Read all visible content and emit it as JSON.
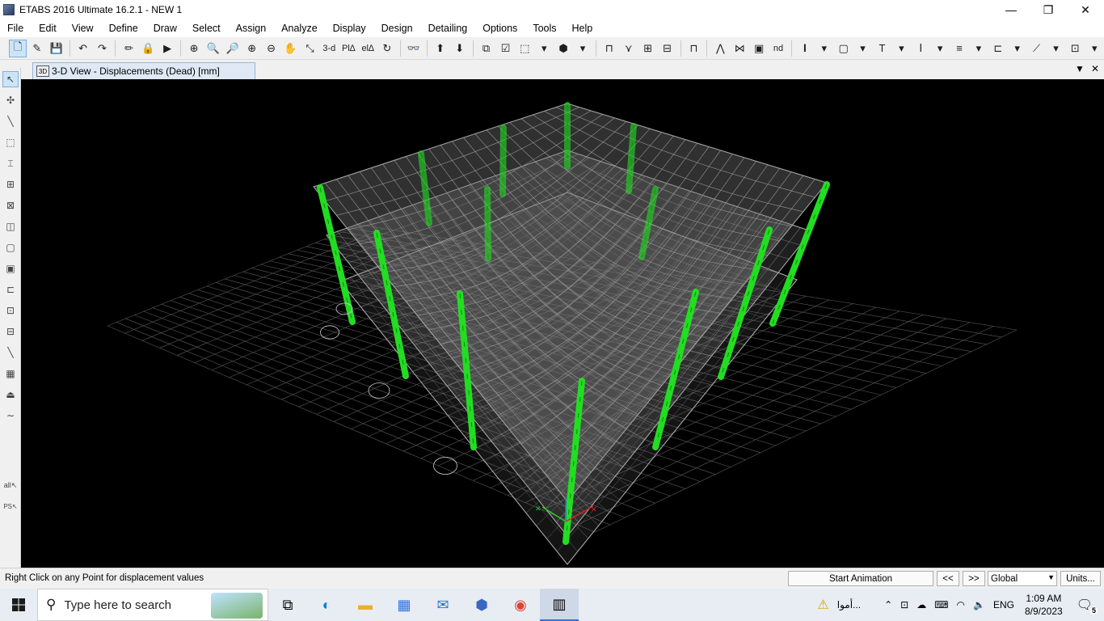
{
  "window": {
    "title": "ETABS 2016 Ultimate 16.2.1 - NEW 1",
    "minimize": "—",
    "maximize": "❐",
    "close": "✕"
  },
  "menu": [
    "File",
    "Edit",
    "View",
    "Define",
    "Draw",
    "Select",
    "Assign",
    "Analyze",
    "Display",
    "Design",
    "Detailing",
    "Options",
    "Tools",
    "Help"
  ],
  "toolbar": {
    "view3d_label": "3-d",
    "plan_label": "Pl∆",
    "elev_label": "el∆",
    "nd_label": "nd"
  },
  "tab": {
    "label": "3-D View   - Displacements (Dead)  [mm]"
  },
  "status": {
    "message": "Right Click on any Point for displacement values",
    "start_animation": "Start Animation",
    "prev": "<<",
    "next": ">>",
    "coord_system": "Global",
    "units": "Units..."
  },
  "taskbar": {
    "search_placeholder": "Type here to search",
    "notification_text": "أموا...",
    "language": "ENG",
    "time": "1:09 AM",
    "date": "8/9/2023",
    "notification_count": "5"
  },
  "left_labels": {
    "all": "all",
    "ps": "PS"
  },
  "colors": {
    "column_green": "#22dd22",
    "mesh_grey": "#9a9a9a",
    "viewport_bg": "#000000",
    "selected_blue": "#cce4f7"
  }
}
